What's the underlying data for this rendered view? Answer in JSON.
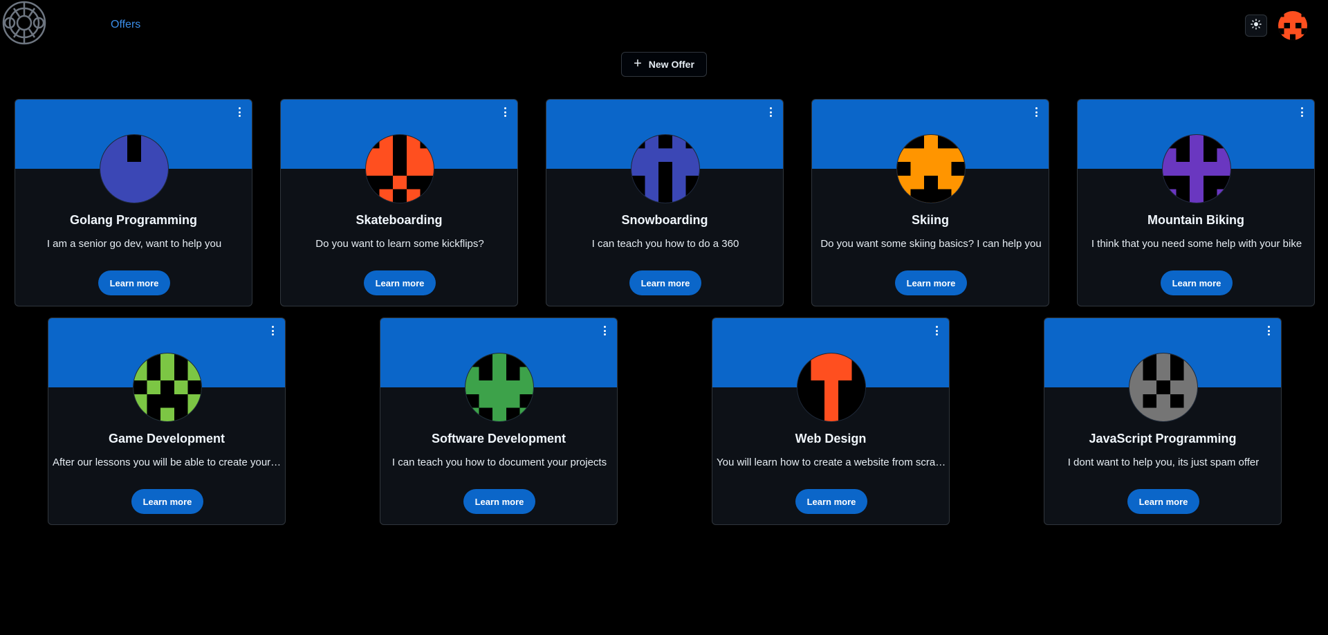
{
  "nav": {
    "offers_link": "Offers"
  },
  "toolbar": {
    "new_offer_label": "New Offer"
  },
  "colors": {
    "accent": "#0b66c9",
    "background": "#000000",
    "card": "#0d1117",
    "link": "#3b8eea"
  },
  "offers": [
    {
      "title": "Golang Programming",
      "description": "I am a senior go dev, want to help you",
      "button": "Learn more",
      "avatar_color": "#3b47b5",
      "avatar_icon": "identicon"
    },
    {
      "title": "Skateboarding",
      "description": "Do you want to learn some kickflips?",
      "button": "Learn more",
      "avatar_color": "#ff4f1f",
      "avatar_icon": "identicon"
    },
    {
      "title": "Snowboarding",
      "description": "I can teach you how to do a 360",
      "button": "Learn more",
      "avatar_color": "#3b47b5",
      "avatar_icon": "identicon"
    },
    {
      "title": "Skiing",
      "description": "Do you want some skiing basics? I can help you",
      "button": "Learn more",
      "avatar_color": "#ff9500",
      "avatar_icon": "identicon"
    },
    {
      "title": "Mountain Biking",
      "description": "I think that you need some help with your bike",
      "button": "Learn more",
      "avatar_color": "#6a37c0",
      "avatar_icon": "identicon"
    },
    {
      "title": "Game Development",
      "description": "After our lessons you will be able to create your game",
      "button": "Learn more",
      "avatar_color": "#7cc644",
      "avatar_icon": "identicon"
    },
    {
      "title": "Software Development",
      "description": "I can teach you how to document your projects",
      "button": "Learn more",
      "avatar_color": "#3da24a",
      "avatar_icon": "identicon"
    },
    {
      "title": "Web Design",
      "description": "You will learn how to create a website from scratch",
      "button": "Learn more",
      "avatar_color": "#ff4f1f",
      "avatar_icon": "identicon"
    },
    {
      "title": "JavaScript Programming",
      "description": "I dont want to help you, its just spam offer",
      "button": "Learn more",
      "avatar_color": "#757575",
      "avatar_icon": "identicon"
    }
  ]
}
